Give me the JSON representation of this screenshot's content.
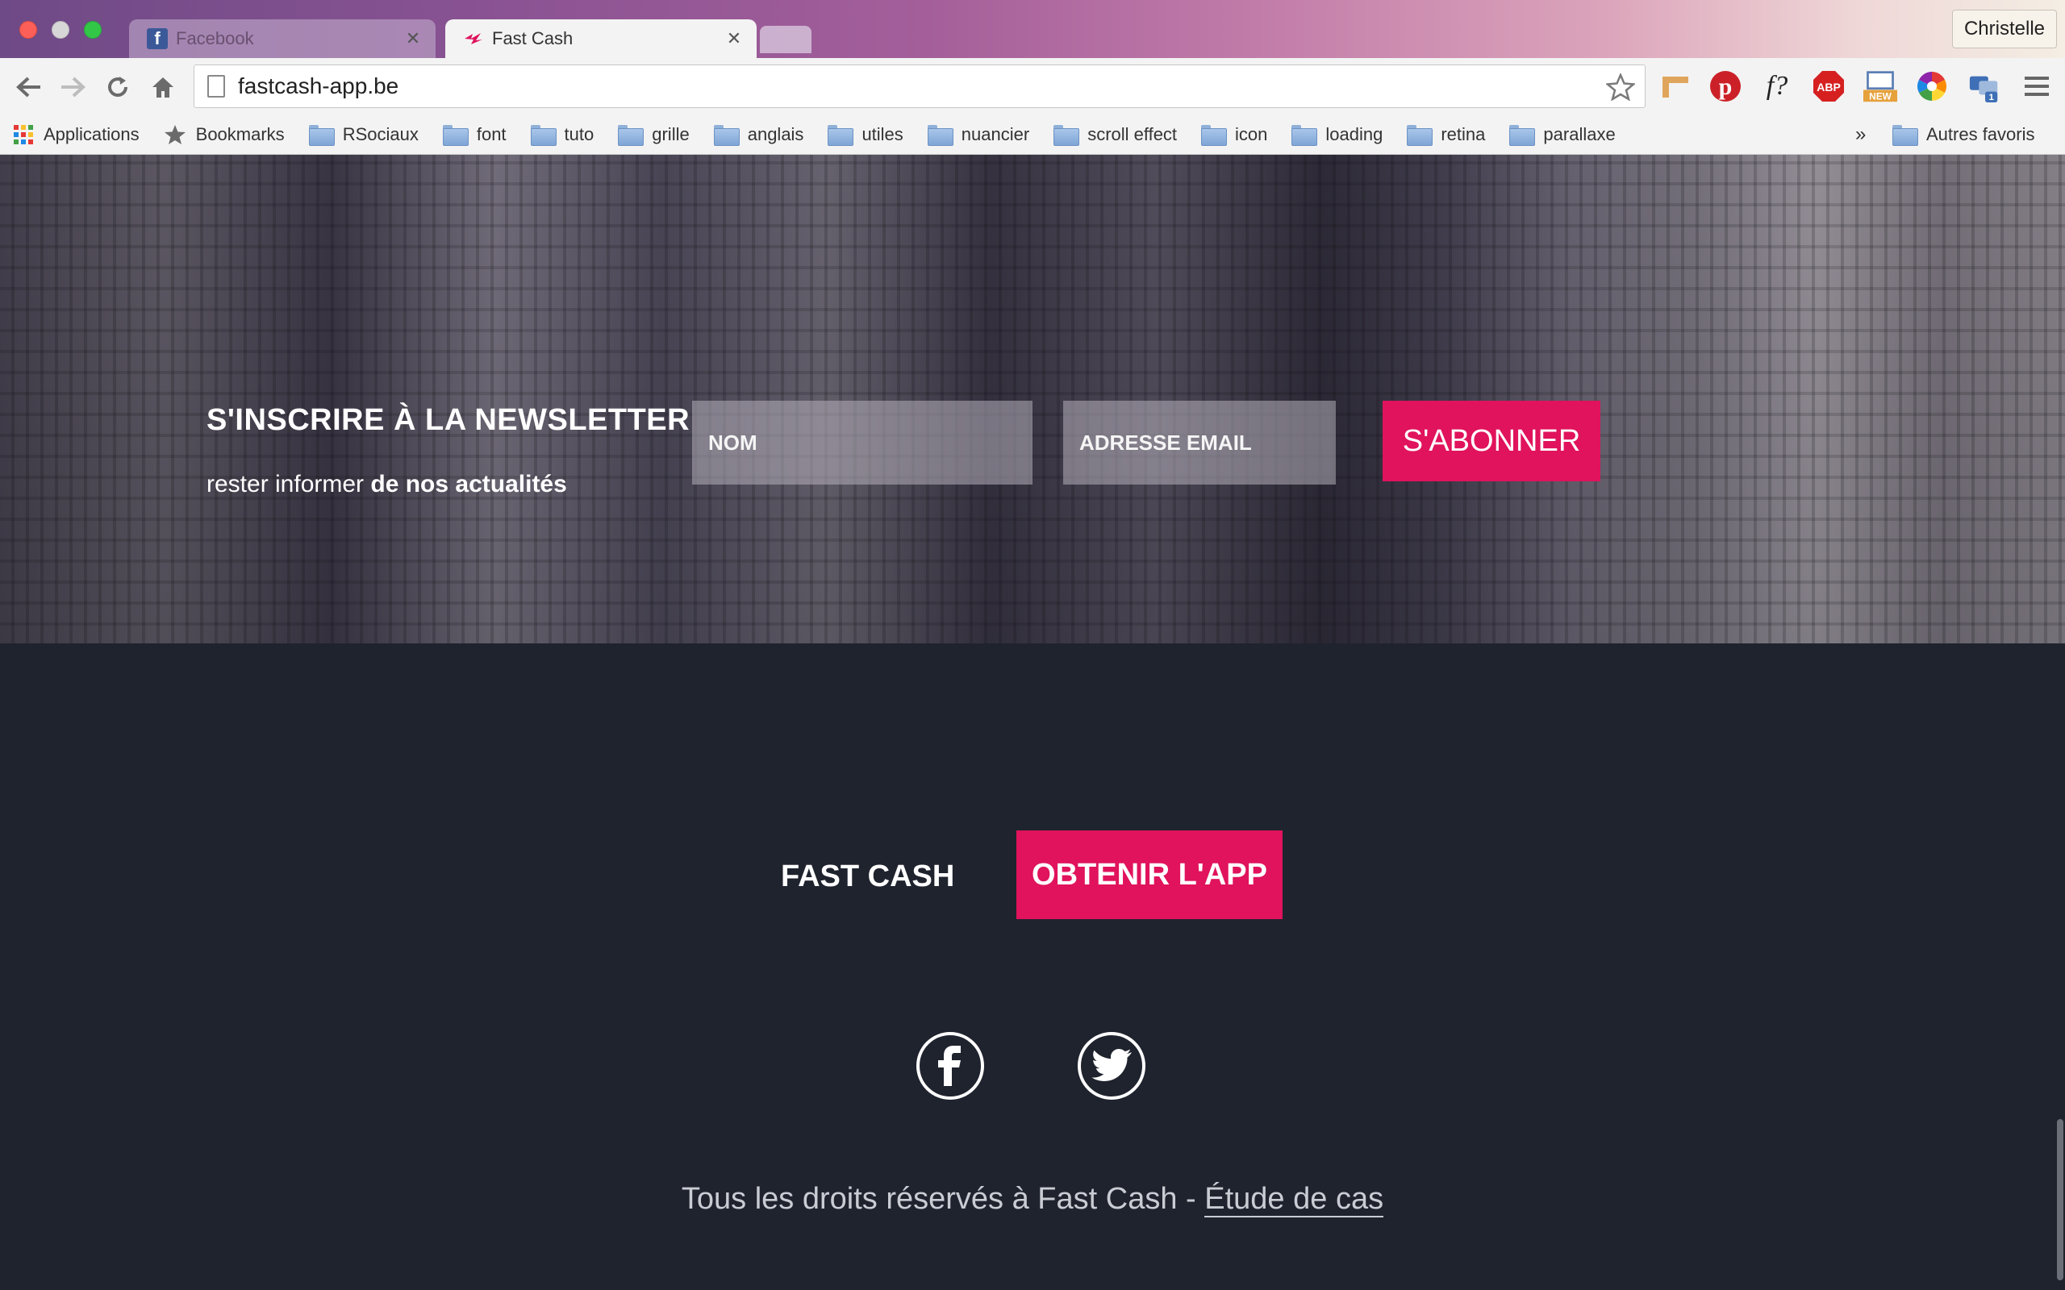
{
  "window": {
    "profile_name": "Christelle"
  },
  "tabs": [
    {
      "title": "Facebook",
      "active": false,
      "favicon": "facebook-icon"
    },
    {
      "title": "Fast Cash",
      "active": true,
      "favicon": "fastcash-icon"
    }
  ],
  "toolbar": {
    "url": "fastcash-app.be"
  },
  "bookmarks": {
    "items": [
      {
        "label": "Applications",
        "icon": "apps-grid-icon"
      },
      {
        "label": "Bookmarks",
        "icon": "star-icon"
      },
      {
        "label": "RSociaux",
        "icon": "folder-icon"
      },
      {
        "label": "font",
        "icon": "folder-icon"
      },
      {
        "label": "tuto",
        "icon": "folder-icon"
      },
      {
        "label": "grille",
        "icon": "folder-icon"
      },
      {
        "label": "anglais",
        "icon": "folder-icon"
      },
      {
        "label": "utiles",
        "icon": "folder-icon"
      },
      {
        "label": "nuancier",
        "icon": "folder-icon"
      },
      {
        "label": "scroll effect",
        "icon": "folder-icon"
      },
      {
        "label": "icon",
        "icon": "folder-icon"
      },
      {
        "label": "loading",
        "icon": "folder-icon"
      },
      {
        "label": "retina",
        "icon": "folder-icon"
      },
      {
        "label": "parallaxe",
        "icon": "folder-icon"
      }
    ],
    "more": "»",
    "other": "Autres favoris"
  },
  "extensions": {
    "new_badge": "NEW",
    "fonts_label": "f?",
    "adblock_label": "ABP",
    "count_badge": "1"
  },
  "newsletter": {
    "title": "S'INSCRIRE À LA NEWSLETTER",
    "subtitle_normal": "rester informer",
    "subtitle_bold": "de nos actualités",
    "name_placeholder": "NOM",
    "email_placeholder": "ADRESSE EMAIL",
    "submit_label": "S'ABONNER"
  },
  "footer": {
    "brand": "FAST CASH",
    "cta_label": "OBTENIR L'APP",
    "social": [
      "facebook-icon",
      "twitter-icon"
    ],
    "copyright_text": "Tous les droits réservés à Fast Cash - ",
    "copyright_link": "Étude de cas"
  },
  "colors": {
    "accent": "#e0135c",
    "footer_bg": "#1f232e"
  }
}
